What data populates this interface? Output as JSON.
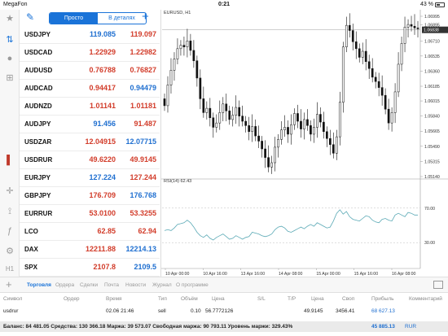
{
  "status": {
    "carrier": "MegaFon",
    "time": "0:21",
    "battery": "43 %"
  },
  "quotes_header": {
    "tab_simple": "Просто",
    "tab_detailed": "В деталях"
  },
  "quotes": [
    {
      "symbol": "USDJPY",
      "bid": "119.085",
      "ask": "119.097",
      "bid_dir": "up",
      "ask_dir": "down"
    },
    {
      "symbol": "USDCAD",
      "bid": "1.22929",
      "ask": "1.22982",
      "bid_dir": "down",
      "ask_dir": "down"
    },
    {
      "symbol": "AUDUSD",
      "bid": "0.76788",
      "ask": "0.76827",
      "bid_dir": "down",
      "ask_dir": "down"
    },
    {
      "symbol": "AUDCAD",
      "bid": "0.94417",
      "ask": "0.94479",
      "bid_dir": "down",
      "ask_dir": "up"
    },
    {
      "symbol": "AUDNZD",
      "bid": "1.01141",
      "ask": "1.01181",
      "bid_dir": "down",
      "ask_dir": "down"
    },
    {
      "symbol": "AUDJPY",
      "bid": "91.456",
      "ask": "91.487",
      "bid_dir": "up",
      "ask_dir": "down"
    },
    {
      "symbol": "USDZAR",
      "bid": "12.04915",
      "ask": "12.07715",
      "bid_dir": "down",
      "ask_dir": "up"
    },
    {
      "symbol": "USDRUR",
      "bid": "49.6220",
      "ask": "49.9145",
      "bid_dir": "down",
      "ask_dir": "down"
    },
    {
      "symbol": "EURJPY",
      "bid": "127.224",
      "ask": "127.244",
      "bid_dir": "up",
      "ask_dir": "down"
    },
    {
      "symbol": "GBPJPY",
      "bid": "176.709",
      "ask": "176.768",
      "bid_dir": "down",
      "ask_dir": "up"
    },
    {
      "symbol": "EURRUR",
      "bid": "53.0100",
      "ask": "53.3255",
      "bid_dir": "down",
      "ask_dir": "down"
    },
    {
      "symbol": "LCO",
      "bid": "62.85",
      "ask": "62.94",
      "bid_dir": "down",
      "ask_dir": "down"
    },
    {
      "symbol": "DAX",
      "bid": "12211.88",
      "ask": "12214.13",
      "bid_dir": "down",
      "ask_dir": "up"
    },
    {
      "symbol": "SPX",
      "bid": "2107.8",
      "ask": "2109.5",
      "bid_dir": "down",
      "ask_dir": "up"
    }
  ],
  "left_tools": [
    {
      "name": "star-icon",
      "glyph": "★",
      "color": "#9a9a9a"
    },
    {
      "name": "arrows-icon",
      "glyph": "⇅",
      "color": "#1a73d8"
    },
    {
      "name": "chat-icon",
      "glyph": "●",
      "color": "#9a9a9a"
    },
    {
      "name": "add-chart-icon",
      "glyph": "⊞",
      "color": "#9a9a9a"
    },
    {
      "name": "indicator-icon",
      "glyph": "▌",
      "color": "#c0392b"
    },
    {
      "name": "crosshair-icon",
      "glyph": "✛",
      "color": "#9a9a9a"
    },
    {
      "name": "objects-icon",
      "glyph": "⟟",
      "color": "#9a9a9a"
    },
    {
      "name": "function-icon",
      "glyph": "ƒ",
      "color": "#9a9a9a"
    },
    {
      "name": "settings-icon",
      "glyph": "⚙",
      "color": "#9a9a9a"
    },
    {
      "name": "timeframe-icon",
      "glyph": "H1",
      "color": "#9a9a9a"
    }
  ],
  "chart": {
    "symbol_title": "EURUSD, H1",
    "indicator_title": "RSI(14) 62.43",
    "price_ticks": [
      "1.06995",
      "1.06895",
      "1.06710",
      "1.06535",
      "1.06360",
      "1.06185",
      "1.06015",
      "1.05840",
      "1.05665",
      "1.05490",
      "1.05315",
      "1.05140"
    ],
    "current_price": "1.06838",
    "rsi_ticks": [
      "70.00",
      "30.00"
    ],
    "time_ticks": [
      "10 Apr 00:00",
      "10 Apr 16:00",
      "13 Apr 16:00",
      "14 Apr 08:00",
      "15 Apr 00:00",
      "15 Apr 16:00",
      "16 Apr 08:00"
    ]
  },
  "chart_data": {
    "type": "line",
    "title": "EURUSD, H1",
    "ylim": [
      1.0514,
      1.06995
    ],
    "close": [
      1.0596,
      1.062,
      1.0637,
      1.065,
      1.0662,
      1.0666,
      1.0664,
      1.0671,
      1.066,
      1.0648,
      1.0628,
      1.0604,
      1.0588,
      1.0593,
      1.0582,
      1.0571,
      1.0576,
      1.0588,
      1.0598,
      1.059,
      1.058,
      1.0585,
      1.0594,
      1.0584,
      1.0578,
      1.0573,
      1.0566,
      1.0572,
      1.0561,
      1.0555,
      1.0546,
      1.0536,
      1.0525,
      1.053,
      1.0548,
      1.0557,
      1.0568,
      1.0571,
      1.0563,
      1.0574,
      1.0587,
      1.0578,
      1.0569,
      1.058,
      1.0573,
      1.0563,
      1.0571,
      1.0586,
      1.0577,
      1.0566,
      1.0558,
      1.0551,
      1.0541,
      1.056,
      1.06,
      1.0664,
      1.0689,
      1.0683,
      1.067,
      1.0662,
      1.0652,
      1.0659,
      1.0647,
      1.0639,
      1.0629,
      1.0624,
      1.0617,
      1.0608,
      1.0592,
      1.0576,
      1.0588,
      1.0612,
      1.0644,
      1.0668,
      1.0687,
      1.069,
      1.0688,
      1.0686,
      1.0685
    ],
    "rsi": [
      44,
      45,
      44,
      47,
      51,
      52,
      53,
      56,
      53,
      48,
      42,
      38,
      36,
      39,
      35,
      33,
      36,
      38,
      40,
      37,
      34,
      35,
      38,
      36,
      34,
      36,
      37,
      42,
      41,
      40,
      38,
      37,
      38,
      40,
      45,
      48,
      49,
      47,
      43,
      42,
      44,
      46,
      48,
      46,
      49,
      51,
      49,
      53,
      51,
      49,
      47,
      48,
      55,
      64,
      68,
      63,
      66,
      60,
      57,
      56,
      55,
      58,
      61,
      60,
      56,
      54,
      53,
      57,
      58,
      56,
      55,
      62,
      64,
      62,
      60,
      65,
      64,
      62,
      62
    ]
  },
  "bottom_tabs": {
    "trade": "Торговля",
    "orders": "Ордера",
    "deals": "Сделки",
    "mail": "Почта",
    "news": "Новости",
    "journal": "Журнал",
    "about": "О программе"
  },
  "table_header": {
    "symbol": "Символ",
    "order": "Ордер",
    "time": "Время",
    "type": "Тип",
    "volume": "Объём",
    "price": "Цена",
    "sl": "S/L",
    "tp": "T/P",
    "cur_price": "Цена",
    "swap": "Своп",
    "profit": "Прибыль",
    "comment": "Комментарий"
  },
  "trade_row": {
    "symbol": "usdrur",
    "time": "02.06 21:46",
    "type": "sell",
    "volume": "0.10",
    "price": "56.7772126",
    "cur_price": "49.9145",
    "swap": "3456.41",
    "profit": "68 627.13"
  },
  "balance": {
    "text": "Баланс: 84 481.05 Средства: 130 366.18 Маржа: 39 573.07 Свободная маржа: 90 793.11 Уровень маржи: 329.43%",
    "profit": "45 885.13",
    "currency": "RUR"
  }
}
